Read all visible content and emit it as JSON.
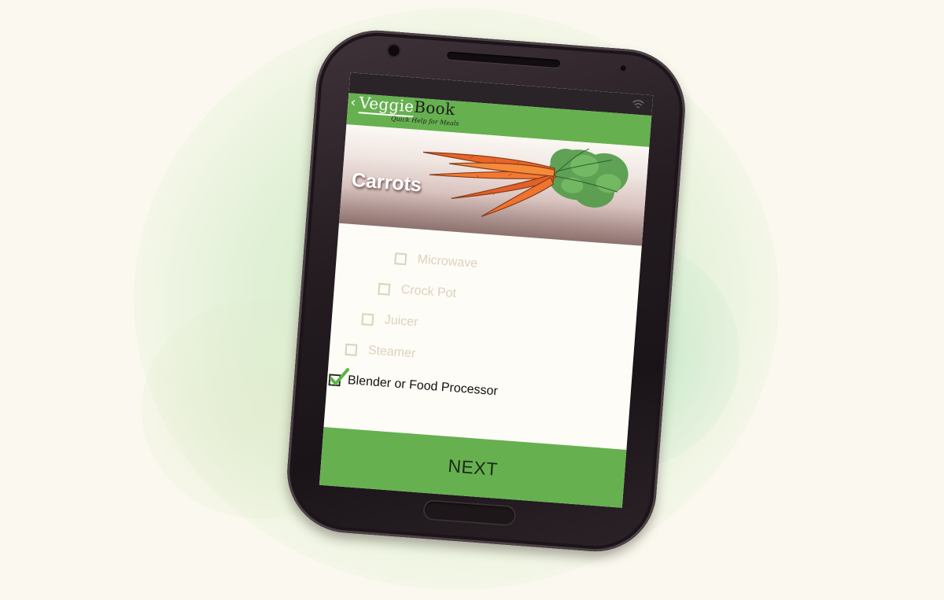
{
  "app": {
    "name_part1": "Veggie",
    "name_part2": "Book",
    "tagline": "Quick Help for Meals"
  },
  "header": {
    "back_icon": "‹"
  },
  "hero": {
    "title": "Carrots",
    "illustration": "carrot-bunch"
  },
  "options": [
    {
      "label": "Microwave",
      "checked": false
    },
    {
      "label": "Crock Pot",
      "checked": false
    },
    {
      "label": "Juicer",
      "checked": false
    },
    {
      "label": "Steamer",
      "checked": false
    },
    {
      "label": "Blender or Food Processor",
      "checked": true
    }
  ],
  "footer": {
    "next_label": "NEXT"
  },
  "colors": {
    "accent_green": "#66b050",
    "check_green": "#5bb544",
    "disabled_text": "#dcd2bd",
    "phone_body": "#241c21",
    "background": "#fbf9ef"
  },
  "icons": {
    "status": "wifi-icon",
    "back": "back-icon",
    "check": "checkmark-icon"
  }
}
